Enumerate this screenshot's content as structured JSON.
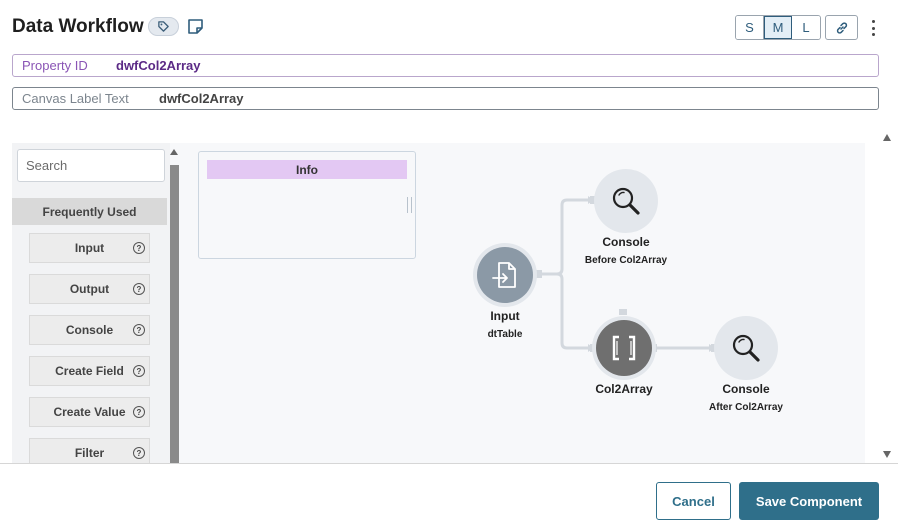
{
  "header": {
    "title": "Data Workflow",
    "size_options": [
      "S",
      "M",
      "L"
    ],
    "size_selected": "M"
  },
  "fields": {
    "property_id": {
      "label": "Property ID",
      "value": "dwfCol2Array"
    },
    "canvas_label": {
      "label": "Canvas Label Text",
      "value": "dwfCol2Array"
    }
  },
  "palette": {
    "search_placeholder": "Search",
    "section_title": "Frequently Used",
    "items": [
      "Input",
      "Output",
      "Console",
      "Create Field",
      "Create Value",
      "Filter"
    ]
  },
  "canvas": {
    "info_note_title": "Info",
    "nodes": [
      {
        "id": "input",
        "label": "Input",
        "sub": "dtTable",
        "icon": "file-import-icon"
      },
      {
        "id": "console1",
        "label": "Console",
        "sub": "Before Col2Array",
        "icon": "magnifier-icon"
      },
      {
        "id": "col2array",
        "label": "Col2Array",
        "sub": "",
        "icon": "brackets-icon"
      },
      {
        "id": "console2",
        "label": "Console",
        "sub": "After Col2Array",
        "icon": "magnifier-icon"
      }
    ]
  },
  "footer": {
    "cancel_label": "Cancel",
    "save_label": "Save Component"
  },
  "colors": {
    "primary": "#2f6f8a",
    "property_label": "#8a55b5",
    "info_header": "#e3c8f3"
  }
}
